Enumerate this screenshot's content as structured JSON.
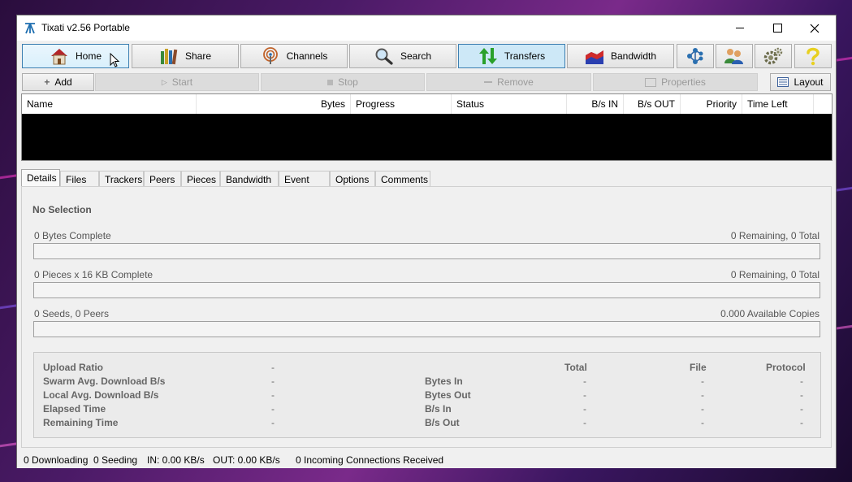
{
  "window": {
    "title": "Tixati v2.56 Portable",
    "controls": [
      "minimize-icon",
      "maximize-icon",
      "close-icon"
    ]
  },
  "main_toolbar": {
    "home": "Home",
    "share": "Share",
    "channels": "Channels",
    "search": "Search",
    "transfers": "Transfers",
    "bandwidth": "Bandwidth",
    "icons": [
      "network-icon",
      "users-icon",
      "gears-icon",
      "help-icon"
    ]
  },
  "transfer_toolbar": {
    "add": "Add",
    "start": "Start",
    "stop": "Stop",
    "remove": "Remove",
    "properties": "Properties",
    "layout": "Layout"
  },
  "transfer_list": {
    "columns": [
      "Name",
      "Bytes",
      "Progress",
      "Status",
      "B/s IN",
      "B/s OUT",
      "Priority",
      "Time Left"
    ]
  },
  "tabs": [
    "Details",
    "Files",
    "Trackers",
    "Peers",
    "Pieces",
    "Bandwidth",
    "Event Log",
    "Options",
    "Comments"
  ],
  "details": {
    "no_selection": "No Selection",
    "bytes_complete": "0 Bytes Complete",
    "bytes_remaining": "0 Remaining,  0 Total",
    "pieces_complete": "0 Pieces  x  16 KB Complete",
    "pieces_remaining": "0 Remaining,  0 Total",
    "seeds_peers": "0 Seeds, 0 Peers",
    "available_copies": "0.000 Available Copies",
    "stats": {
      "left_labels": [
        "Upload Ratio",
        "Swarm Avg. Download B/s",
        "Local Avg. Download B/s",
        "Elapsed Time",
        "Remaining Time"
      ],
      "left_values": [
        "-",
        "-",
        "-",
        "-",
        "-"
      ],
      "headers": [
        "Total",
        "File",
        "Protocol"
      ],
      "right_labels": [
        "Bytes In",
        "Bytes Out",
        "B/s In",
        "B/s Out"
      ],
      "right_values": [
        "-",
        "-",
        "-",
        "-"
      ]
    }
  },
  "statusbar": {
    "downloading": "0 Downloading",
    "seeding": "0 Seeding",
    "in": "IN: 0.00 KB/s",
    "out": "OUT: 0.00 KB/s",
    "connections": "0 Incoming Connections Received"
  }
}
